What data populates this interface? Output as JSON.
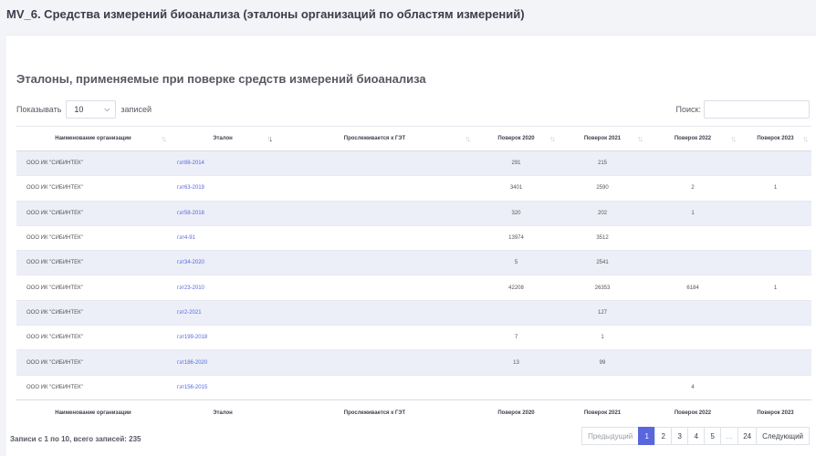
{
  "page": {
    "title": "MV_6. Средства измерений биоанализа (эталоны организаций по областям измерений)"
  },
  "card": {
    "title": "Эталоны, применяемые при поверке средств измерений биоанализа"
  },
  "length": {
    "prefix": "Показывать",
    "value": "10",
    "suffix": "записей"
  },
  "search": {
    "label": "Поиск:",
    "value": ""
  },
  "table": {
    "columns": [
      "Наименование организации",
      "Эталон",
      "Прослеживается к ГЭТ",
      "Поверок 2020",
      "Поверок 2021",
      "Поверок 2022",
      "Поверок 2023"
    ],
    "rows": [
      {
        "org": "ООО ИК \"СИБИНТЕК\"",
        "etalon": "гэт88-2014",
        "get": "",
        "y2020": "291",
        "y2021": "215",
        "y2022": "",
        "y2023": ""
      },
      {
        "org": "ООО ИК \"СИБИНТЕК\"",
        "etalon": "гэт63-2019",
        "get": "",
        "y2020": "3401",
        "y2021": "2590",
        "y2022": "2",
        "y2023": "1"
      },
      {
        "org": "ООО ИК \"СИБИНТЕК\"",
        "etalon": "гэт58-2018",
        "get": "",
        "y2020": "320",
        "y2021": "202",
        "y2022": "1",
        "y2023": ""
      },
      {
        "org": "ООО ИК \"СИБИНТЕК\"",
        "etalon": "гэт4-91",
        "get": "",
        "y2020": "13974",
        "y2021": "3512",
        "y2022": "",
        "y2023": ""
      },
      {
        "org": "ООО ИК \"СИБИНТЕК\"",
        "etalon": "гэт34-2020",
        "get": "",
        "y2020": "5",
        "y2021": "2541",
        "y2022": "",
        "y2023": ""
      },
      {
        "org": "ООО ИК \"СИБИНТЕК\"",
        "etalon": "гэт23-2010",
        "get": "",
        "y2020": "42208",
        "y2021": "26353",
        "y2022": "6184",
        "y2023": "1"
      },
      {
        "org": "ООО ИК \"СИБИНТЕК\"",
        "etalon": "гэт2-2021",
        "get": "",
        "y2020": "",
        "y2021": "127",
        "y2022": "",
        "y2023": ""
      },
      {
        "org": "ООО ИК \"СИБИНТЕК\"",
        "etalon": "гэт199-2018",
        "get": "",
        "y2020": "7",
        "y2021": "1",
        "y2022": "",
        "y2023": ""
      },
      {
        "org": "ООО ИК \"СИБИНТЕК\"",
        "etalon": "гэт186-2020",
        "get": "",
        "y2020": "13",
        "y2021": "99",
        "y2022": "",
        "y2023": ""
      },
      {
        "org": "ООО ИК \"СИБИНТЕК\"",
        "etalon": "гэт156-2015",
        "get": "",
        "y2020": "",
        "y2021": "",
        "y2022": "4",
        "y2023": ""
      }
    ]
  },
  "info": "Записи с 1 по 10, всего записей: 235",
  "pagination": {
    "prev": "Предыдущий",
    "pages": [
      "1",
      "2",
      "3",
      "4",
      "5",
      "…",
      "24"
    ],
    "active": "1",
    "next": "Следующий"
  },
  "colors": {
    "accent": "#5867dd",
    "stripe": "#eceff8",
    "background": "#f3f4f8"
  },
  "icons": {
    "sort": "sort-both-icon",
    "select": "chevron-down-icon"
  }
}
